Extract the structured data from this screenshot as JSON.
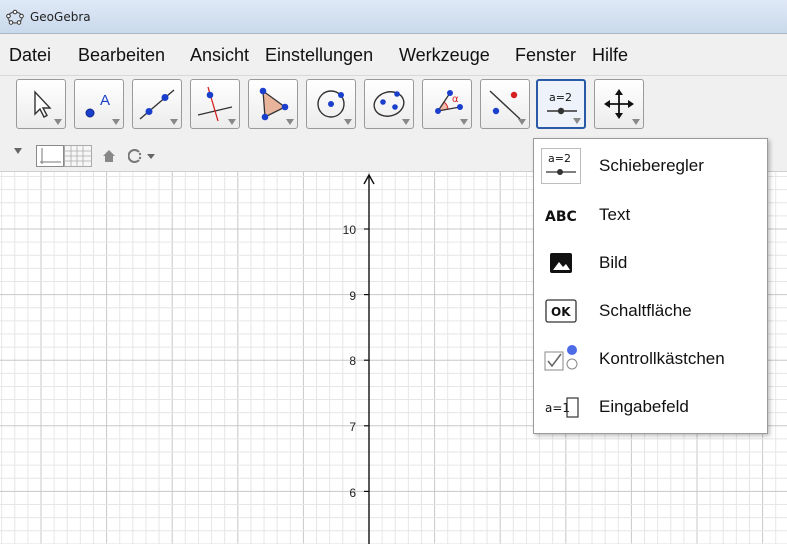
{
  "window": {
    "title": "GeoGebra"
  },
  "menubar": {
    "items": [
      "Datei",
      "Bearbeiten",
      "Ansicht",
      "Einstellungen",
      "Werkzeuge",
      "Fenster",
      "Hilfe"
    ]
  },
  "toolbar": {
    "tools": [
      {
        "name": "move-tool-icon"
      },
      {
        "name": "point-tool-icon",
        "label": "A"
      },
      {
        "name": "line-tool-icon"
      },
      {
        "name": "perpendicular-line-tool-icon"
      },
      {
        "name": "polygon-tool-icon"
      },
      {
        "name": "circle-tool-icon"
      },
      {
        "name": "conic-tool-icon"
      },
      {
        "name": "angle-tool-icon",
        "label": "α"
      },
      {
        "name": "reflect-tool-icon"
      },
      {
        "name": "slider-tool-icon",
        "label": "a=2",
        "active": true
      },
      {
        "name": "move-graphics-view-tool-icon"
      }
    ]
  },
  "popup_menu": {
    "items": [
      {
        "icon": "slider-icon",
        "icon_text": "a=2",
        "label": "Schieberegler"
      },
      {
        "icon": "text-icon",
        "icon_text": "ABC",
        "label": "Text"
      },
      {
        "icon": "image-icon",
        "label": "Bild"
      },
      {
        "icon": "button-icon",
        "icon_text": "OK",
        "label": "Schaltfläche"
      },
      {
        "icon": "checkbox-icon",
        "label": "Kontrollkästchen"
      },
      {
        "icon": "input-box-icon",
        "icon_text": "a=1",
        "label": "Eingabefeld"
      }
    ]
  },
  "graphics_view": {
    "y_axis_labels": [
      "10",
      "9",
      "8",
      "7",
      "6"
    ]
  },
  "colors": {
    "accent": "#2a5aa6",
    "point": "#1a3fcc",
    "grid_minor": "#e6e6e6",
    "grid_major": "#c8c8c8"
  }
}
